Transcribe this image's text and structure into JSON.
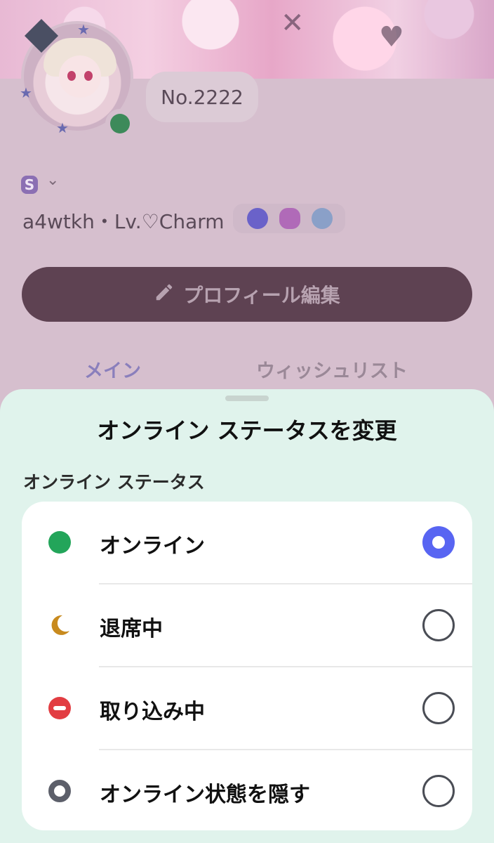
{
  "profile": {
    "number_bubble": "No.2222",
    "server_tag": "S",
    "username_line": "a4wtkh・Lv.♡Charm",
    "edit_button_label": "プロフィール編集",
    "tabs": [
      {
        "label": "メイン"
      },
      {
        "label": "ウィッシュリスト"
      }
    ]
  },
  "sheet": {
    "title": "オンライン ステータスを変更",
    "section_label": "オンライン ステータス",
    "options": [
      {
        "label": "オンライン",
        "icon": "online-dot-icon",
        "color": "#23a55a",
        "selected": true
      },
      {
        "label": "退席中",
        "icon": "crescent-moon-icon",
        "color": "#c88a1e",
        "selected": false
      },
      {
        "label": "取り込み中",
        "icon": "do-not-disturb-icon",
        "color": "#e23d42",
        "selected": false
      },
      {
        "label": "オンライン状態を隠す",
        "icon": "invisible-ring-icon",
        "color": "#5c5f6a",
        "selected": false
      }
    ]
  },
  "colors": {
    "accent": "#5865f2",
    "sheet_bg": "#e0f3ec"
  }
}
